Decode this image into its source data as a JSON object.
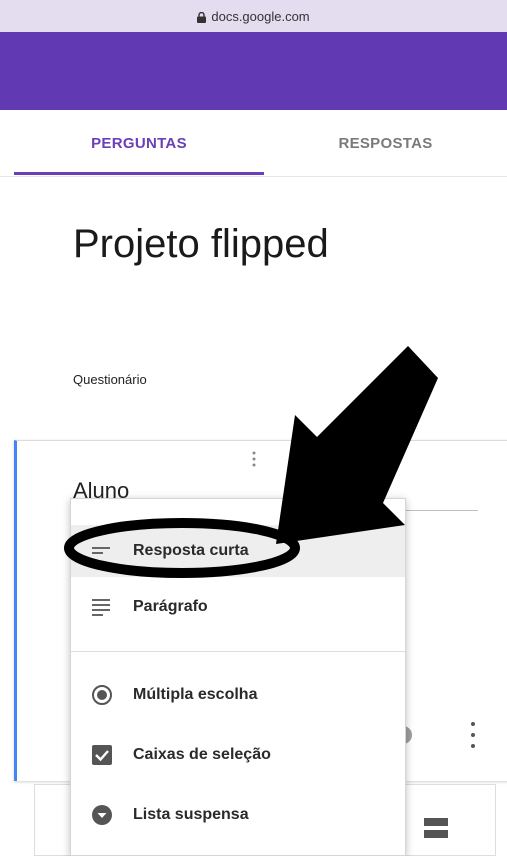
{
  "browser": {
    "url": "docs.google.com"
  },
  "tabs": {
    "questions": "PERGUNTAS",
    "answers": "RESPOSTAS"
  },
  "form": {
    "title": "Projeto flipped",
    "description": "Questionário"
  },
  "question": {
    "title": "Aluno"
  },
  "question_type_menu": {
    "items": [
      {
        "label": "Resposta curta",
        "icon": "short-answer-icon"
      },
      {
        "label": "Parágrafo",
        "icon": "paragraph-icon"
      },
      {
        "label": "Múltipla escolha",
        "icon": "radio-icon"
      },
      {
        "label": "Caixas de seleção",
        "icon": "checkbox-icon"
      },
      {
        "label": "Lista suspensa",
        "icon": "dropdown-icon"
      }
    ]
  },
  "colors": {
    "header": "#6139b3",
    "accent": "#6a3fb8",
    "card_border": "#4285f4",
    "url_bar": "#e4dcef"
  }
}
